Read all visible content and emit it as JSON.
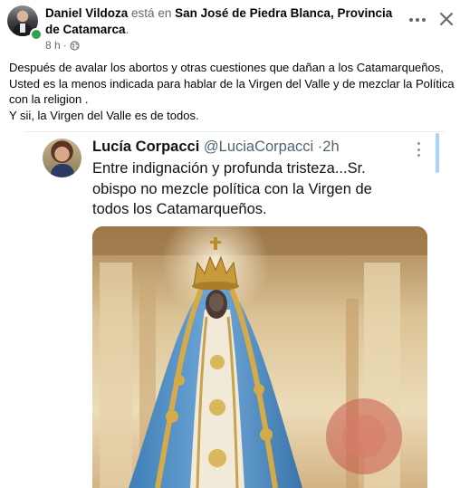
{
  "post": {
    "author": "Daniel Vildoza",
    "connector": "está en",
    "location": "San José de Piedra Blanca, Provincia de Catamarca",
    "location_suffix": ".",
    "time": "8 h",
    "separator": "·",
    "text_lines": [
      "Después de avalar los abortos y otras cuestiones que dañan a los Catamarqueños, Usted es la menos indicada para hablar de la Virgen del Valle y de mezclar la Política con la religion .",
      "Y sii, la Virgen del Valle es de todos."
    ]
  },
  "tweet": {
    "name": "Lucía Corpacci",
    "handle": "@LuciaCorpacci",
    "separator": "·",
    "time": "2h",
    "text": "Entre indignación y profunda tristeza...Sr. obispo no mezcle política con la Virgen de todos los Catamarqueños."
  },
  "icons": {
    "more": "more-horizontal-icon",
    "close": "close-icon",
    "privacy": "globe-icon",
    "tweet_more": "more-vertical-icon"
  },
  "colors": {
    "online": "#31a24c",
    "muted_text": "#65676b",
    "tweet_handle": "#536471"
  }
}
